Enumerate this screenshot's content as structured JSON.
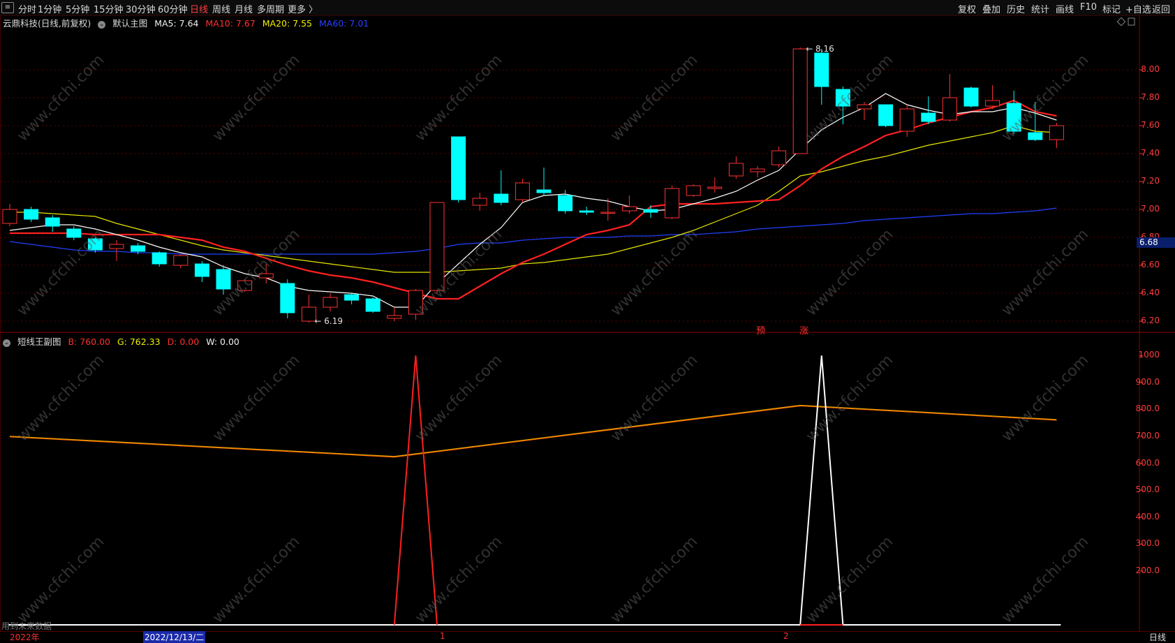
{
  "toolbar": {
    "menu_icon": "≡",
    "periods": [
      "分时",
      "1分钟",
      "5分钟",
      "15分钟",
      "30分钟",
      "60分钟",
      "日线",
      "周线",
      "月线",
      "多周期",
      "更多 〉"
    ],
    "active_period": "日线",
    "right_buttons": [
      "复权",
      "叠加",
      "历史",
      "统计",
      "画线",
      "F10",
      "标记",
      "+自选",
      "返回"
    ]
  },
  "main_legend": {
    "stock": "云鼎科技(日线,前复权)",
    "template": "默认主图",
    "ma5": "MA5: 7.64",
    "ma10": "MA10: 7.67",
    "ma20": "MA20: 7.55",
    "ma60": "MA60: 7.01"
  },
  "sub_legend": {
    "name": "短线王副图",
    "b": "B: 760.00",
    "g": "G: 762.33",
    "d": "D: 0.00",
    "w": "W: 0.00"
  },
  "price_axis": [
    "8.00",
    "7.80",
    "7.60",
    "7.40",
    "7.20",
    "7.00",
    "6.80",
    "6.60",
    "6.40",
    "6.20"
  ],
  "current_price_flag": "6.68",
  "indicator_axis": [
    "1000",
    "900.0",
    "800.0",
    "700.0",
    "600.0",
    "500.0",
    "400.0",
    "300.0",
    "200.0"
  ],
  "annotations": {
    "high": "8.16",
    "low": "6.19",
    "yu": "预",
    "zhang": "涨"
  },
  "bottom": {
    "year": "2022年",
    "date_cursor": "2022/12/13/二",
    "month1": "1",
    "month2": "2",
    "period_label": "日线",
    "hint": "用到未来数据"
  },
  "watermark": "www.cfchi.com",
  "colors": {
    "up": "#ff3232",
    "down": "#00ffff",
    "ma5": "#ffffff",
    "ma10": "#ff2020",
    "ma20": "#e6e600",
    "ma60": "#2040ff",
    "signal_d": "#ff2020",
    "signal_w": "#ffffff"
  },
  "chart_data": {
    "type": "candlestick",
    "price_range": [
      6.15,
      8.3
    ],
    "candles": [
      {
        "o": 6.9,
        "c": 7.0,
        "h": 7.04,
        "l": 6.88
      },
      {
        "o": 7.0,
        "c": 6.93,
        "h": 7.02,
        "l": 6.91
      },
      {
        "o": 6.94,
        "c": 6.88,
        "h": 6.96,
        "l": 6.84
      },
      {
        "o": 6.86,
        "c": 6.8,
        "h": 6.88,
        "l": 6.78
      },
      {
        "o": 6.79,
        "c": 6.71,
        "h": 6.8,
        "l": 6.69
      },
      {
        "o": 6.72,
        "c": 6.75,
        "h": 6.78,
        "l": 6.63
      },
      {
        "o": 6.74,
        "c": 6.7,
        "h": 6.76,
        "l": 6.68
      },
      {
        "o": 6.69,
        "c": 6.61,
        "h": 6.7,
        "l": 6.59
      },
      {
        "o": 6.6,
        "c": 6.67,
        "h": 6.68,
        "l": 6.58
      },
      {
        "o": 6.61,
        "c": 6.52,
        "h": 6.63,
        "l": 6.48
      },
      {
        "o": 6.57,
        "c": 6.43,
        "h": 6.6,
        "l": 6.39
      },
      {
        "o": 6.42,
        "c": 6.49,
        "h": 6.5,
        "l": 6.41
      },
      {
        "o": 6.51,
        "c": 6.54,
        "h": 6.61,
        "l": 6.47
      },
      {
        "o": 6.47,
        "c": 6.26,
        "h": 6.5,
        "l": 6.22
      },
      {
        "o": 6.2,
        "c": 6.3,
        "h": 6.39,
        "l": 6.19
      },
      {
        "o": 6.3,
        "c": 6.37,
        "h": 6.4,
        "l": 6.27
      },
      {
        "o": 6.39,
        "c": 6.35,
        "h": 6.4,
        "l": 6.32
      },
      {
        "o": 6.36,
        "c": 6.27,
        "h": 6.37,
        "l": 6.26
      },
      {
        "o": 6.22,
        "c": 6.24,
        "h": 6.3,
        "l": 6.2
      },
      {
        "o": 6.25,
        "c": 6.42,
        "h": 6.43,
        "l": 6.21
      },
      {
        "o": 6.42,
        "c": 7.05,
        "h": 7.05,
        "l": 6.4
      },
      {
        "o": 7.52,
        "c": 7.07,
        "h": 7.52,
        "l": 7.05
      },
      {
        "o": 7.03,
        "c": 7.08,
        "h": 7.12,
        "l": 6.99
      },
      {
        "o": 7.11,
        "c": 7.05,
        "h": 7.28,
        "l": 7.03
      },
      {
        "o": 7.07,
        "c": 7.19,
        "h": 7.22,
        "l": 7.05
      },
      {
        "o": 7.14,
        "c": 7.12,
        "h": 7.3,
        "l": 7.1
      },
      {
        "o": 7.1,
        "c": 6.99,
        "h": 7.14,
        "l": 6.97
      },
      {
        "o": 6.99,
        "c": 6.98,
        "h": 7.02,
        "l": 6.96
      },
      {
        "o": 6.98,
        "c": 6.98,
        "h": 7.08,
        "l": 6.92
      },
      {
        "o": 6.99,
        "c": 7.02,
        "h": 7.1,
        "l": 6.97
      },
      {
        "o": 7.0,
        "c": 6.98,
        "h": 7.03,
        "l": 6.94
      },
      {
        "o": 6.94,
        "c": 7.15,
        "h": 7.17,
        "l": 6.93
      },
      {
        "o": 7.1,
        "c": 7.17,
        "h": 7.18,
        "l": 7.09
      },
      {
        "o": 7.15,
        "c": 7.16,
        "h": 7.23,
        "l": 7.12
      },
      {
        "o": 7.24,
        "c": 7.33,
        "h": 7.38,
        "l": 7.22
      },
      {
        "o": 7.27,
        "c": 7.29,
        "h": 7.31,
        "l": 7.23
      },
      {
        "o": 7.32,
        "c": 7.42,
        "h": 7.45,
        "l": 7.3
      },
      {
        "o": 7.4,
        "c": 8.15,
        "h": 8.16,
        "l": 7.4
      },
      {
        "o": 8.12,
        "c": 7.88,
        "h": 8.15,
        "l": 7.75
      },
      {
        "o": 7.86,
        "c": 7.74,
        "h": 7.88,
        "l": 7.61
      },
      {
        "o": 7.72,
        "c": 7.75,
        "h": 7.77,
        "l": 7.64
      },
      {
        "o": 7.75,
        "c": 7.6,
        "h": 7.75,
        "l": 7.59
      },
      {
        "o": 7.56,
        "c": 7.72,
        "h": 7.75,
        "l": 7.52
      },
      {
        "o": 7.69,
        "c": 7.63,
        "h": 7.81,
        "l": 7.61
      },
      {
        "o": 7.64,
        "c": 7.8,
        "h": 7.97,
        "l": 7.63
      },
      {
        "o": 7.87,
        "c": 7.74,
        "h": 7.88,
        "l": 7.73
      },
      {
        "o": 7.74,
        "c": 7.78,
        "h": 7.89,
        "l": 7.72
      },
      {
        "o": 7.76,
        "c": 7.56,
        "h": 7.85,
        "l": 7.54
      },
      {
        "o": 7.55,
        "c": 7.5,
        "h": 7.77,
        "l": 7.49
      },
      {
        "o": 7.5,
        "c": 7.6,
        "h": 7.62,
        "l": 7.44
      }
    ],
    "ma5": [
      6.85,
      6.87,
      6.89,
      6.89,
      6.86,
      6.82,
      6.78,
      6.73,
      6.69,
      6.66,
      6.59,
      6.54,
      6.51,
      6.45,
      6.42,
      6.41,
      6.4,
      6.38,
      6.3,
      6.3,
      6.47,
      6.61,
      6.75,
      6.87,
      7.05,
      7.1,
      7.11,
      7.08,
      7.06,
      7.02,
      6.99,
      7.0,
      7.04,
      7.08,
      7.13,
      7.21,
      7.28,
      7.43,
      7.57,
      7.66,
      7.73,
      7.83,
      7.75,
      7.71,
      7.68,
      7.7,
      7.7,
      7.73,
      7.69,
      7.64
    ],
    "ma10": [
      6.83,
      6.83,
      6.83,
      6.83,
      6.82,
      6.82,
      6.82,
      6.82,
      6.8,
      6.78,
      6.73,
      6.7,
      6.65,
      6.6,
      6.56,
      6.53,
      6.51,
      6.48,
      6.44,
      6.4,
      6.36,
      6.36,
      6.45,
      6.54,
      6.62,
      6.68,
      6.75,
      6.82,
      6.85,
      6.89,
      7.02,
      7.04,
      7.04,
      7.04,
      7.05,
      7.06,
      7.07,
      7.17,
      7.29,
      7.38,
      7.45,
      7.53,
      7.57,
      7.62,
      7.66,
      7.7,
      7.73,
      7.78,
      7.7,
      7.67
    ],
    "ma20": [
      6.98,
      6.98,
      6.97,
      6.96,
      6.95,
      6.9,
      6.86,
      6.82,
      6.78,
      6.74,
      6.71,
      6.69,
      6.67,
      6.65,
      6.63,
      6.61,
      6.59,
      6.57,
      6.55,
      6.55,
      6.55,
      6.56,
      6.57,
      6.58,
      6.61,
      6.62,
      6.64,
      6.66,
      6.68,
      6.72,
      6.76,
      6.8,
      6.85,
      6.91,
      6.97,
      7.03,
      7.13,
      7.24,
      7.27,
      7.31,
      7.35,
      7.38,
      7.42,
      7.46,
      7.49,
      7.52,
      7.55,
      7.6,
      7.56,
      7.55
    ],
    "ma60": [
      6.77,
      6.75,
      6.73,
      6.71,
      6.7,
      6.7,
      6.69,
      6.69,
      6.68,
      6.68,
      6.68,
      6.68,
      6.68,
      6.68,
      6.68,
      6.68,
      6.68,
      6.68,
      6.69,
      6.7,
      6.72,
      6.75,
      6.76,
      6.76,
      6.78,
      6.79,
      6.8,
      6.8,
      6.8,
      6.81,
      6.81,
      6.82,
      6.82,
      6.83,
      6.84,
      6.86,
      6.87,
      6.88,
      6.89,
      6.9,
      6.92,
      6.93,
      6.94,
      6.95,
      6.96,
      6.97,
      6.97,
      6.98,
      6.99,
      7.01
    ],
    "indicator_range": [
      0,
      1050
    ],
    "indicator_b": [
      {
        "i": 0,
        "v": 700
      },
      {
        "i": 18,
        "v": 625
      },
      {
        "i": 37,
        "v": 815
      },
      {
        "i": 49,
        "v": 762
      }
    ],
    "signal_d": [
      {
        "i": 18,
        "v": 0
      },
      {
        "i": 19,
        "v": 1000
      },
      {
        "i": 20,
        "v": 0
      }
    ],
    "signal_w": [
      {
        "i": 37,
        "v": 0
      },
      {
        "i": 38,
        "v": 1000
      },
      {
        "i": 39,
        "v": 0
      }
    ]
  }
}
